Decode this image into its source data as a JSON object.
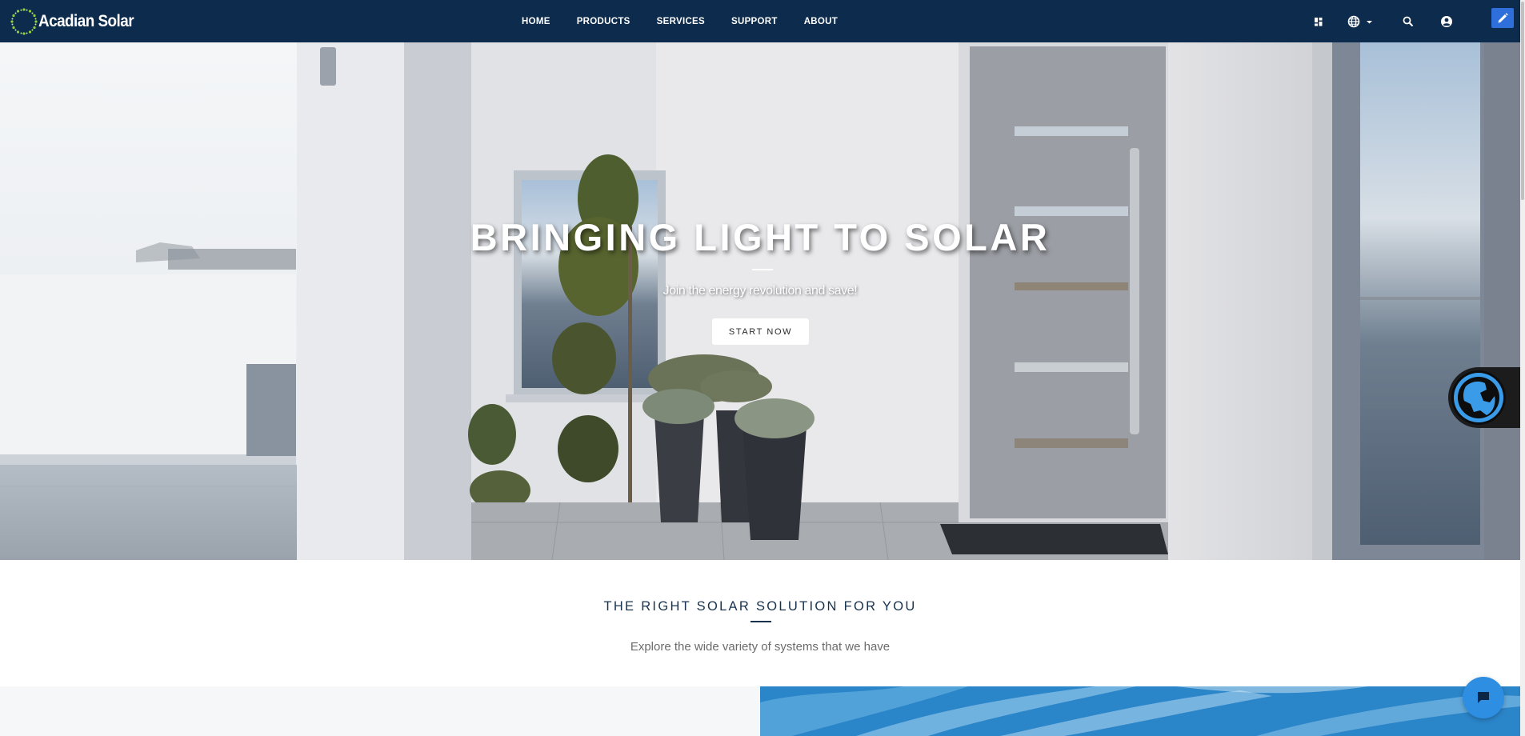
{
  "brand": {
    "name": "Acadian Solar"
  },
  "nav": {
    "items": [
      {
        "label": "HOME"
      },
      {
        "label": "PRODUCTS"
      },
      {
        "label": "SERVICES"
      },
      {
        "label": "SUPPORT"
      },
      {
        "label": "ABOUT"
      }
    ],
    "icons": [
      "apps-icon",
      "globe-icon",
      "chevron-down-icon",
      "search-icon",
      "user-icon",
      "edit-icon"
    ]
  },
  "hero": {
    "title": "BRINGING LIGHT TO SOLAR",
    "subtitle": "Join the energy revolution and save!",
    "cta_label": "START NOW"
  },
  "section": {
    "title": "THE RIGHT SOLAR SOLUTION FOR YOU",
    "subtitle": "Explore the wide variety of systems that we have"
  },
  "widgets": {
    "globe": "globe-icon",
    "chat": "chat-icon"
  },
  "colors": {
    "navbar": "#0c2b4d",
    "accent_blue": "#2e8fe2",
    "edit_button": "#2e6fdb",
    "section_heading": "#17324f"
  }
}
